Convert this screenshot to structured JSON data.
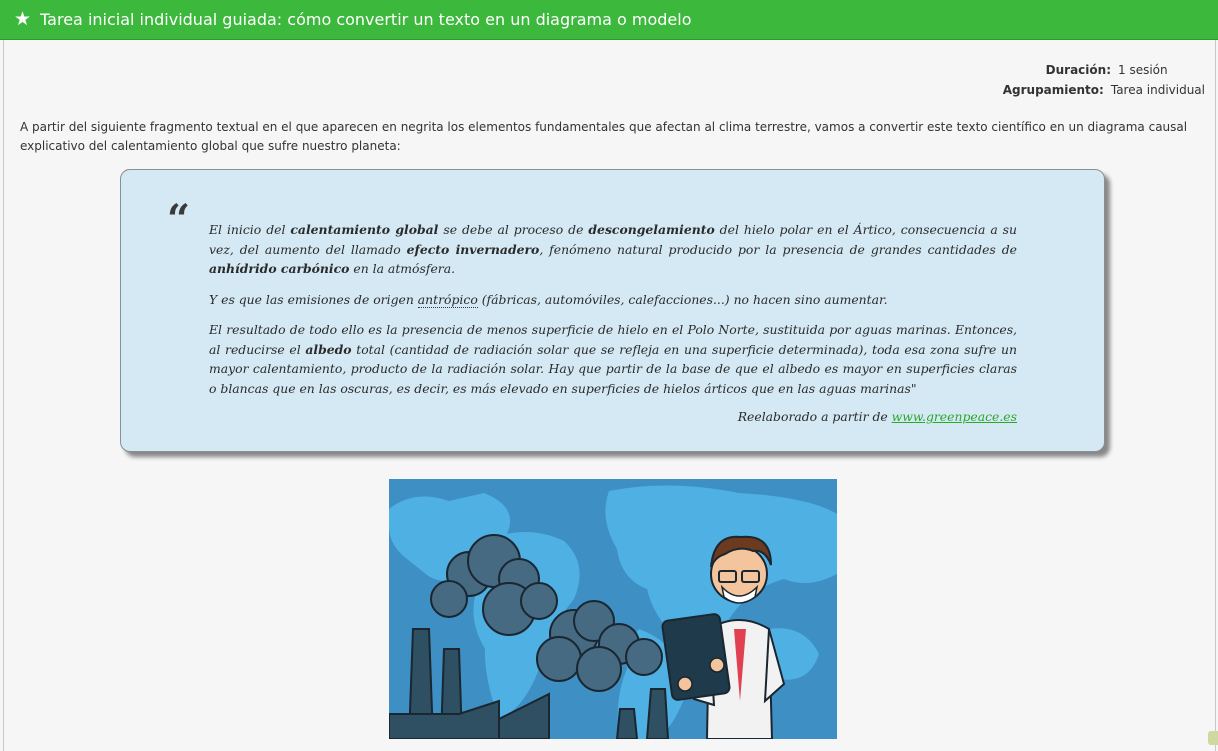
{
  "header": {
    "title": "Tarea inicial individual guiada: cómo convertir un texto en un diagrama o modelo"
  },
  "meta": {
    "duration_label": "Duración:",
    "duration_value": "1 sesión",
    "grouping_label": "Agrupamiento:",
    "grouping_value": "Tarea individual"
  },
  "intro": "A partir del siguiente fragmento textual en el que aparecen en negrita los elementos fundamentales que afectan al clima terrestre, vamos a convertir este texto científico en un diagrama causal explicativo del calentamiento global que sufre nuestro planeta:",
  "quote": {
    "mark": "“",
    "p1": [
      "El inicio del ",
      "calentamiento global",
      " se debe al proceso de ",
      "descongelamiento",
      " del hielo polar en el Ártico, consecuencia a su vez, del aumento del llamado ",
      "efecto invernadero",
      ", fenómeno natural producido por la presencia de grandes cantidades de ",
      "anhídrido carbónico",
      " en la atmósfera."
    ],
    "p2": [
      "Y es que las emisiones de origen ",
      "antrópico",
      " (fábricas, automóviles, calefacciones...) no hacen sino aumentar."
    ],
    "p3": [
      "El resultado de todo ello es la presencia de menos superficie de hielo en el Polo Norte, sustituida por aguas marinas. Entonces, al reducirse el ",
      "albedo",
      " total (cantidad de radiación solar que se refleja en una superficie determinada), toda esa zona sufre un mayor calentamiento, producto de la radiación solar. Hay que partir de la base de que el albedo es mayor en superficies claras o blancas que en las oscuras, es decir, es más elevado en superficies de hielos árticos que en las aguas marinas\""
    ],
    "source_prefix": "Reelaborado a partir de ",
    "source_link": "www.greenpeace.es"
  },
  "colors": {
    "header_bg": "#3cb83c",
    "quote_bg": "#d4e9f4",
    "link": "#2aa82a"
  },
  "icons": {
    "header": "star-icon"
  }
}
